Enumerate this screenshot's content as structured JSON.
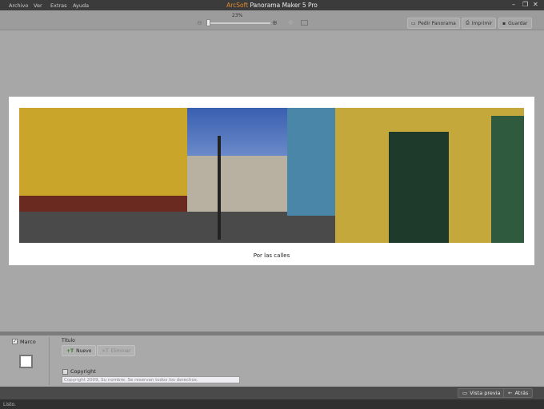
{
  "app": {
    "brand": "ArcSoft",
    "title": "Panorama Maker 5 Pro"
  },
  "menu": [
    "Archivo",
    "Ver",
    "Extras",
    "Ayuda"
  ],
  "window_controls": {
    "minimize": "–",
    "restore": "❐",
    "close": "✕"
  },
  "toolbar": {
    "zoom_level": "23%",
    "zoom_fraction": 0.05,
    "order_label": "Pedir Panorama",
    "print_label": "Imprimir",
    "save_label": "Guardar"
  },
  "canvas": {
    "caption": "Por las calles"
  },
  "panel": {
    "frame_label": "Marco",
    "frame_checked": true,
    "title_label": "Título",
    "new_label": "Nuevo",
    "delete_label": "Eliminar",
    "copyright_label": "Copyright",
    "copyright_checked": false,
    "copyright_value": "Copyright 2009, Su nombre. Se reservan todos los derechos."
  },
  "bottom": {
    "preview_label": "Vista previa",
    "back_label": "Atrás"
  },
  "status": "Listo."
}
